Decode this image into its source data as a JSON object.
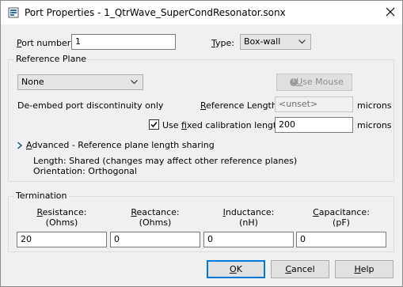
{
  "window": {
    "title": "Port Properties - 1_QtrWave_SuperCondResonator.sonx"
  },
  "port_number": {
    "label": "Port number:",
    "value": "1"
  },
  "type": {
    "label": "Type:",
    "value": "Box-wall"
  },
  "reference_plane": {
    "group_label": "Reference Plane",
    "select_value": "None",
    "use_mouse_label": "Use Mouse",
    "deembed_text": "De-embed port discontinuity only",
    "ref_length_label": "Reference Length:",
    "ref_length_value": "<unset>",
    "ref_length_units": "microns",
    "fixed_cal_label": "Use fixed calibration length:",
    "fixed_cal_checked": true,
    "fixed_cal_value": "200",
    "fixed_cal_units": "microns",
    "advanced_label": "Advanced - Reference plane length sharing",
    "length_info": "Length: Shared (changes may affect other reference planes)",
    "orientation_info": "Orientation: Orthogonal"
  },
  "termination": {
    "group_label": "Termination",
    "resistance": {
      "label": "Resistance:",
      "unit": "(Ohms)",
      "value": "20"
    },
    "reactance": {
      "label": "Reactance:",
      "unit": "(Ohms)",
      "value": "0"
    },
    "inductance": {
      "label": "Inductance:",
      "unit": "(nH)",
      "value": "0"
    },
    "capacitance": {
      "label": "Capacitance:",
      "unit": "(pF)",
      "value": "0"
    }
  },
  "buttons": {
    "ok": "OK",
    "cancel": "Cancel",
    "help": "Help"
  },
  "colors": {
    "accent": "#0078d7",
    "window_bg": "#f0f0f0",
    "title_bg": "#ffffff"
  }
}
